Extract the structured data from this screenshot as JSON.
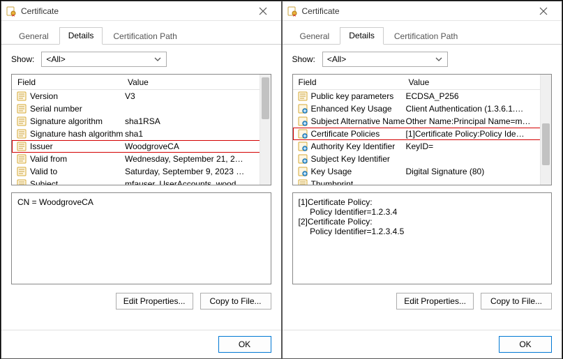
{
  "dialogs": [
    {
      "title": "Certificate",
      "tabs": {
        "general": "General",
        "details": "Details",
        "certpath": "Certification Path"
      },
      "show": {
        "label": "Show:",
        "value": "<All>"
      },
      "columns": {
        "field": "Field",
        "value": "Value"
      },
      "rows": [
        {
          "icon": "prop",
          "field": "Version",
          "value": "V3",
          "hl": false
        },
        {
          "icon": "prop",
          "field": "Serial number",
          "value": "",
          "hl": false
        },
        {
          "icon": "prop",
          "field": "Signature algorithm",
          "value": "sha1RSA",
          "hl": false
        },
        {
          "icon": "prop",
          "field": "Signature hash algorithm",
          "value": "sha1",
          "hl": false
        },
        {
          "icon": "prop",
          "field": "Issuer",
          "value": "WoodgroveCA",
          "hl": true
        },
        {
          "icon": "prop",
          "field": "Valid from",
          "value": "Wednesday, September 21, 2…",
          "hl": false
        },
        {
          "icon": "prop",
          "field": "Valid to",
          "value": "Saturday, September 9, 2023 …",
          "hl": false
        },
        {
          "icon": "prop",
          "field": "Subject",
          "value": "mfauser, UserAccounts, wood…",
          "hl": false
        }
      ],
      "detail": "CN = WoodgroveCA",
      "buttons": {
        "edit": "Edit Properties...",
        "copy": "Copy to File...",
        "ok": "OK"
      }
    },
    {
      "title": "Certificate",
      "tabs": {
        "general": "General",
        "details": "Details",
        "certpath": "Certification Path"
      },
      "show": {
        "label": "Show:",
        "value": "<All>"
      },
      "columns": {
        "field": "Field",
        "value": "Value"
      },
      "rows": [
        {
          "icon": "ext",
          "field": "Public key parameters",
          "value": "ECDSA_P256",
          "hl": false
        },
        {
          "icon": "ext2",
          "field": "Enhanced Key Usage",
          "value": "Client Authentication (1.3.6.1.…",
          "hl": false
        },
        {
          "icon": "ext2",
          "field": "Subject Alternative Name",
          "value": "Other Name:Principal Name=m…",
          "hl": false
        },
        {
          "icon": "ext2",
          "field": "Certificate Policies",
          "value": "[1]Certificate Policy:Policy Ide…",
          "hl": true
        },
        {
          "icon": "ext2",
          "field": "Authority Key Identifier",
          "value": "KeyID=",
          "hl": false
        },
        {
          "icon": "ext2",
          "field": "Subject Key Identifier",
          "value": "",
          "hl": false
        },
        {
          "icon": "ext2",
          "field": "Key Usage",
          "value": "Digital Signature (80)",
          "hl": false
        },
        {
          "icon": "prop",
          "field": "Thumbprint",
          "value": "",
          "hl": false
        }
      ],
      "detail": "[1]Certificate Policy:\n     Policy Identifier=1.2.3.4\n[2]Certificate Policy:\n     Policy Identifier=1.2.3.4.5",
      "buttons": {
        "edit": "Edit Properties...",
        "copy": "Copy to File...",
        "ok": "OK"
      }
    }
  ]
}
